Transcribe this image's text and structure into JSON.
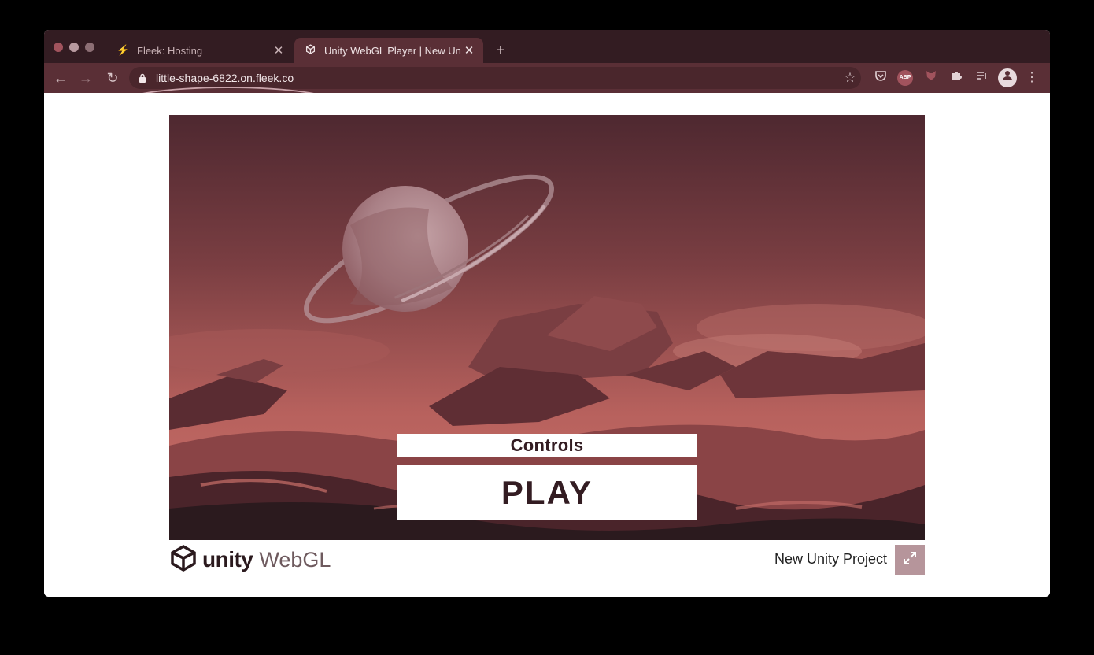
{
  "browser": {
    "tabs": [
      {
        "title": "Fleek: Hosting",
        "icon": "fleek-icon",
        "active": false
      },
      {
        "title": "Unity WebGL Player | New Unity Project",
        "icon": "unity-icon",
        "active": true
      }
    ],
    "new_tab_symbol": "+",
    "close_symbol": "✕",
    "url": "little-shape-6822.on.fleek.co",
    "extensions": [
      "pocket-icon",
      "adblock-icon",
      "fox-icon",
      "puzzle-icon",
      "queue-icon",
      "avatar-icon"
    ],
    "abp_label": "ABP"
  },
  "game": {
    "controls_label": "Controls",
    "play_label": "PLAY"
  },
  "footer": {
    "logo_unity": "unity",
    "logo_webgl": "WebGL",
    "project_title": "New Unity Project"
  },
  "colors": {
    "chrome_dark": "#331c22",
    "chrome_toolbar": "#5a2f36",
    "sky_top": "#4e2830",
    "sky_mid": "#b7615d",
    "rock_dark": "#2b1a1e"
  }
}
